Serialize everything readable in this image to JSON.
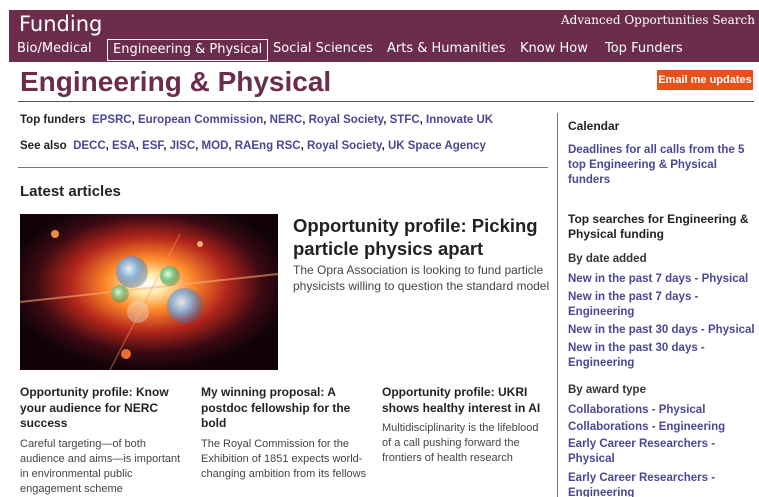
{
  "header": {
    "brand": "Funding",
    "advanced_search": "Advanced Opportunities Search",
    "nav": [
      "Bio/Medical",
      "Engineering & Physical",
      "Social Sciences",
      "Arts & Humanities",
      "Know How",
      "Top Funders"
    ],
    "active_nav": "Engineering & Physical"
  },
  "page": {
    "title": "Engineering & Physical",
    "email_button": "Email me updates"
  },
  "funders": {
    "top_label": "Top funders",
    "top": [
      "EPSRC",
      "European Commission",
      "NERC",
      "Royal Society",
      "STFC",
      "Innovate UK"
    ],
    "see_also_label": "See also",
    "see_also": [
      "DECC",
      "ESA",
      "ESF",
      "JISC",
      "MOD",
      "RAEng RSC",
      "Royal Society",
      "UK Space Agency"
    ]
  },
  "latest": {
    "heading": "Latest articles",
    "feature": {
      "title": "Opportunity profile: Picking particle physics apart",
      "description": "The Opra Association is looking to fund particle physicists willing to question the standard model"
    },
    "articles": [
      {
        "title": "Opportunity profile: Know your audience for NERC success",
        "description": "Careful targeting—of both audience and aims—is important in environmental public engagement scheme"
      },
      {
        "title": "My winning proposal: A postdoc fellowship for the bold",
        "description": "The Royal Commission for the Exhibition of 1851 expects world-changing ambition from its fellows"
      },
      {
        "title": "Opportunity profile: UKRI shows healthy interest in AI",
        "description": "Multidisciplinarity is the lifeblood of a call pushing forward the frontiers of health research"
      }
    ]
  },
  "sidebar": {
    "calendar_heading": "Calendar",
    "calendar_link": "Deadlines for all calls from the 5 top Engineering & Physical funders",
    "top_searches_heading": "Top searches for Engineering & Physical funding",
    "by_date_label": "By date added",
    "by_date": [
      "New in the past 7 days - Physical",
      "New in the past 7 days - Engineering",
      "New in the past 30 days - Physical",
      "New in the past 30 days - Engineering"
    ],
    "by_award_label": "By award type",
    "by_award": [
      "Collaborations - Physical",
      "Collaborations - Engineering",
      "Early Career Researchers - Physical",
      "Early Career Researchers - Engineering"
    ]
  },
  "colors": {
    "brand": "#6b2d4b",
    "link": "#4b4792",
    "button": "#e8501a"
  }
}
